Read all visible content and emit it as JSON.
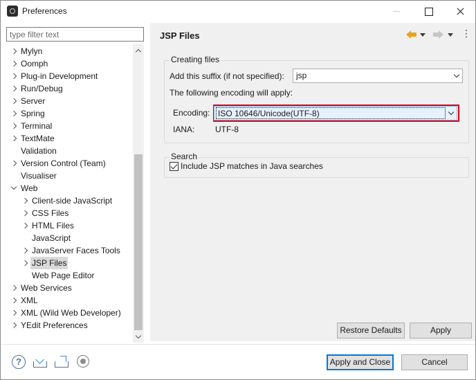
{
  "window": {
    "title": "Preferences"
  },
  "filter": {
    "placeholder": "type filter text"
  },
  "tree": {
    "items": [
      {
        "label": "Mylyn",
        "level": 0,
        "expander": "collapsed"
      },
      {
        "label": "Oomph",
        "level": 0,
        "expander": "collapsed"
      },
      {
        "label": "Plug-in Development",
        "level": 0,
        "expander": "collapsed"
      },
      {
        "label": "Run/Debug",
        "level": 0,
        "expander": "collapsed"
      },
      {
        "label": "Server",
        "level": 0,
        "expander": "collapsed"
      },
      {
        "label": "Spring",
        "level": 0,
        "expander": "collapsed"
      },
      {
        "label": "Terminal",
        "level": 0,
        "expander": "collapsed"
      },
      {
        "label": "TextMate",
        "level": 0,
        "expander": "collapsed"
      },
      {
        "label": "Validation",
        "level": 0,
        "expander": "none"
      },
      {
        "label": "Version Control (Team)",
        "level": 0,
        "expander": "collapsed"
      },
      {
        "label": "Visualiser",
        "level": 0,
        "expander": "none"
      },
      {
        "label": "Web",
        "level": 0,
        "expander": "expanded"
      },
      {
        "label": "Client-side JavaScript",
        "level": 1,
        "expander": "collapsed"
      },
      {
        "label": "CSS Files",
        "level": 1,
        "expander": "collapsed"
      },
      {
        "label": "HTML Files",
        "level": 1,
        "expander": "collapsed"
      },
      {
        "label": "JavaScript",
        "level": 1,
        "expander": "none"
      },
      {
        "label": "JavaServer Faces Tools",
        "level": 1,
        "expander": "collapsed"
      },
      {
        "label": "JSP Files",
        "level": 1,
        "expander": "collapsed",
        "selected": true
      },
      {
        "label": "Web Page Editor",
        "level": 1,
        "expander": "none"
      },
      {
        "label": "Web Services",
        "level": 0,
        "expander": "collapsed"
      },
      {
        "label": "XML",
        "level": 0,
        "expander": "collapsed"
      },
      {
        "label": "XML (Wild Web Developer)",
        "level": 0,
        "expander": "collapsed"
      },
      {
        "label": "YEdit Preferences",
        "level": 0,
        "expander": "collapsed"
      }
    ]
  },
  "page": {
    "title": "JSP Files"
  },
  "creating_files": {
    "legend": "Creating files",
    "suffix_label": "Add this suffix (if not specified):",
    "suffix_value": "jsp",
    "encoding_intro": "The following encoding will apply:",
    "encoding_label": "Encoding:",
    "encoding_value": "ISO 10646/Unicode(UTF-8)",
    "iana_label": "IANA:",
    "iana_value": "UTF-8"
  },
  "search": {
    "legend": "Search",
    "include_label": "Include JSP matches in Java searches",
    "include_checked": true
  },
  "buttons": {
    "restore_defaults": "Restore Defaults",
    "apply": "Apply",
    "apply_and_close": "Apply and Close",
    "cancel": "Cancel"
  },
  "colors": {
    "highlight_border": "#e0001b",
    "default_button_border": "#0078d7",
    "nav_back": "#e8a321"
  }
}
